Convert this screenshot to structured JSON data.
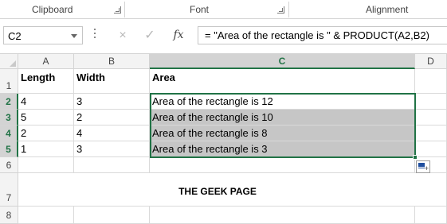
{
  "ribbon": {
    "groups": [
      {
        "label": "Clipboard"
      },
      {
        "label": "Font"
      },
      {
        "label": "Alignment"
      }
    ]
  },
  "formula_bar": {
    "name_box": "C2",
    "cancel_icon": "×",
    "enter_icon": "✓",
    "fx_label": "fx",
    "formula": "= \"Area of the rectangle is \" & PRODUCT(A2,B2)"
  },
  "grid": {
    "columns": [
      "A",
      "B",
      "C",
      "D"
    ],
    "selected_column": "C",
    "rows": [
      "1",
      "2",
      "3",
      "4",
      "5",
      "6",
      "7",
      "8"
    ],
    "selected_rows": [
      "2",
      "3",
      "4",
      "5"
    ],
    "headers": {
      "a": "Length",
      "b": "Width",
      "c": "Area"
    },
    "data": [
      {
        "a": "4",
        "b": "3",
        "c": "Area of the rectangle is 12"
      },
      {
        "a": "5",
        "b": "2",
        "c": "Area of the rectangle is 10"
      },
      {
        "a": "2",
        "b": "4",
        "c": "Area of the rectangle is 8"
      },
      {
        "a": "1",
        "b": "3",
        "c": "Area of the rectangle is 3"
      }
    ],
    "watermark": "THE GEEK PAGE"
  },
  "colors": {
    "accent": "#217346",
    "selection_fill": "#c6c6c6",
    "header_bg": "#f3f3f3"
  },
  "icons": [
    "launcher-icon",
    "cancel-icon",
    "enter-icon",
    "function-icon",
    "dropdown-icon",
    "quick-analysis-icon"
  ]
}
